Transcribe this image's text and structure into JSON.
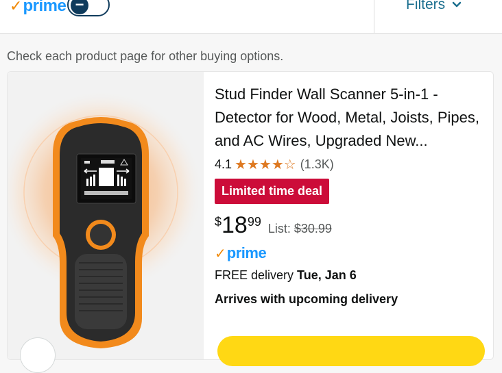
{
  "topbar": {
    "prime_check": "✓",
    "prime_word": "prime",
    "toggle_symbol": "−",
    "filters_label": "Filters"
  },
  "notice": "Check each product page for other buying options.",
  "product": {
    "title": "Stud Finder Wall Scanner 5-in-1 - Detector for Wood, Metal, Joists, Pipes, and AC Wires, Upgraded New...",
    "rating": "4.1",
    "stars": "★★★★☆",
    "rating_value": 4.1,
    "review_count": "(1.3K)",
    "deal_badge": "Limited time deal",
    "price_currency": "$",
    "price_whole": "18",
    "price_fraction": "99",
    "list_label": "List:",
    "list_price": "$30.99",
    "prime_check": "✓",
    "prime_word": "prime",
    "delivery_prefix": "FREE delivery",
    "delivery_date": "Tue, Jan 6",
    "arrives_text": "Arrives with upcoming delivery"
  },
  "colors": {
    "prime_blue": "#1a98ff",
    "prime_orange": "#f08804",
    "deal_red": "#cc0c39",
    "star_orange": "#de7921",
    "cart_yellow": "#ffd814",
    "link_teal": "#1a6e8e"
  },
  "icons": {
    "filters": "chevron-down-icon",
    "toggle": "minus-icon",
    "product_image": "stud-finder-device"
  }
}
